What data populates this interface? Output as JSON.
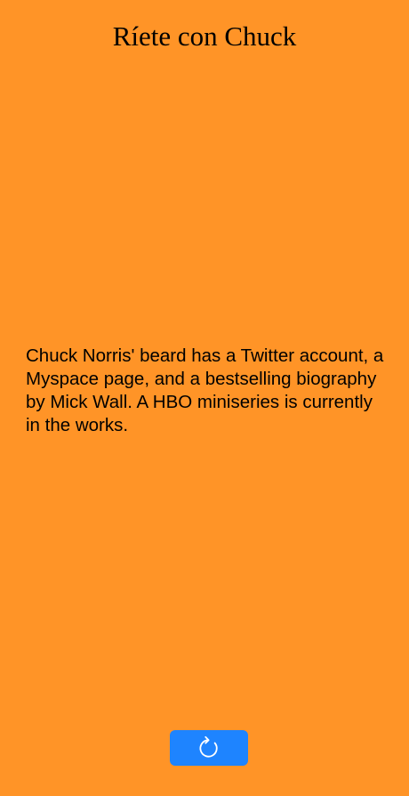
{
  "app": {
    "title": "Ríete con Chuck",
    "background_color": "#FF9427"
  },
  "joke": {
    "text": "Chuck Norris' beard has a Twitter account, a Myspace page, and a bestselling biography by Mick Wall. A HBO miniseries is currently in the works."
  },
  "refresh_button": {
    "icon": "refresh-icon",
    "color": "#1E84FF"
  }
}
